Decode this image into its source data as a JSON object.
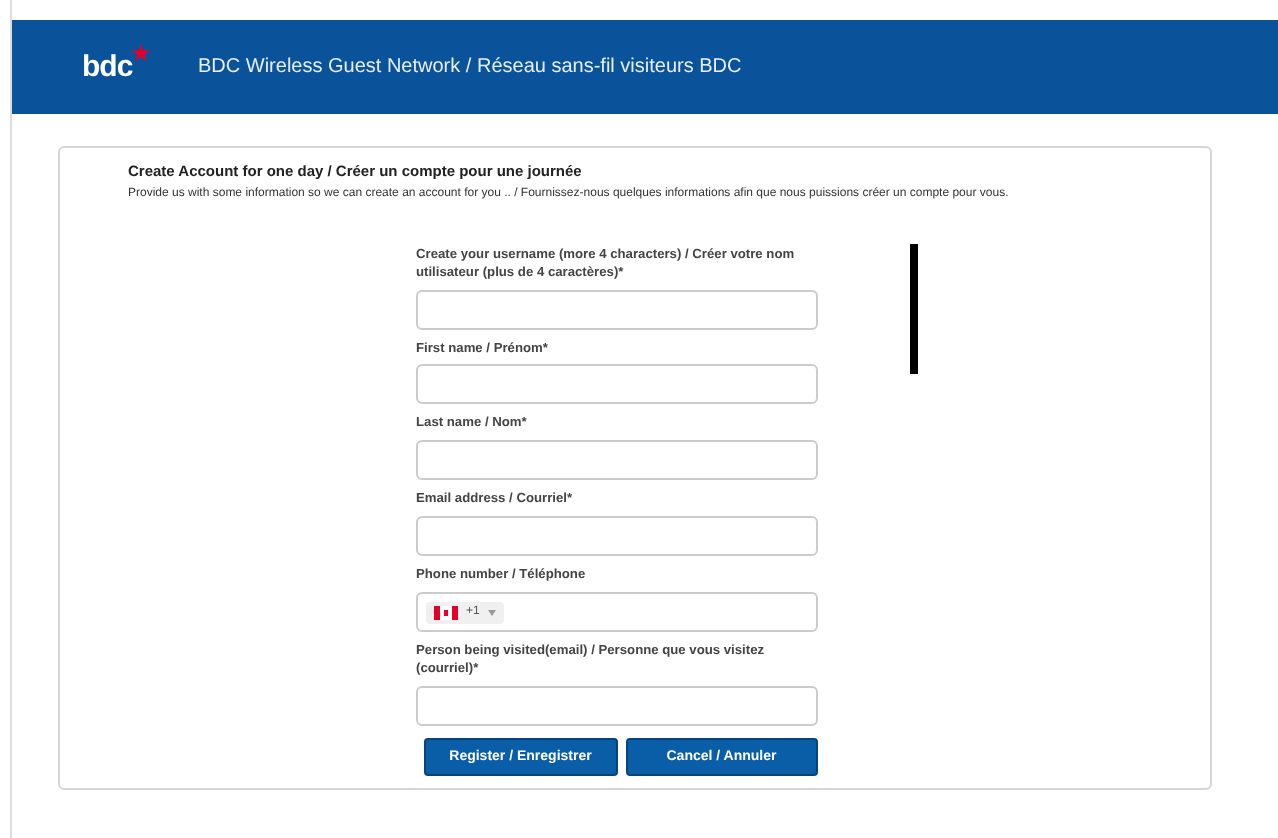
{
  "header": {
    "logo": "bdc",
    "title": "BDC Wireless Guest Network / Réseau sans-fil visiteurs BDC"
  },
  "card": {
    "title": "Create Account for one day / Créer un compte pour une journée",
    "description": "Provide us with some information so we can create an account for you .. / Fournissez-nous quelques informations afin que nous puissions créer un compte pour vous."
  },
  "fields": [
    {
      "kind": "text",
      "label": "Create your username (more 4 characters) / Créer votre nom utilisateur (plus de 4 caractères)*"
    },
    {
      "kind": "text",
      "label": "First name / Prénom*"
    },
    {
      "kind": "text",
      "label": "Last name / Nom*"
    },
    {
      "kind": "text",
      "label": "Email address / Courriel*"
    },
    {
      "kind": "phone",
      "label": "Phone number / Téléphone",
      "dial_code": "+1"
    },
    {
      "kind": "text",
      "label": "Person being visited(email) / Personne que vous visitez (courriel)*"
    }
  ],
  "buttons": [
    "Register / Enregistrer",
    "Cancel / Annuler"
  ]
}
